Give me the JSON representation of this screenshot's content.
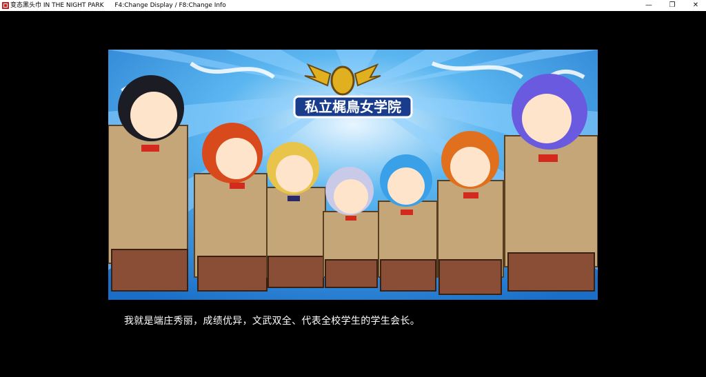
{
  "window": {
    "title": "变态黑头巾 IN THE NIGHT PARK",
    "hotkeys": "F4:Change Display / F8:Change Info",
    "minimize_glyph": "—",
    "maximize_glyph": "❐",
    "close_glyph": "✕"
  },
  "scene": {
    "school_emblem_text": "私立梶鳥女学院",
    "message": "我就是端庄秀丽，成绩优异，文武双全、代表全校学生的学生会长。"
  },
  "colors": {
    "sky_blue": "#2c8ee0",
    "uniform_tan": "#c4a678",
    "skirt_brown": "#8a4e36",
    "bow_red": "#d42a1e"
  }
}
